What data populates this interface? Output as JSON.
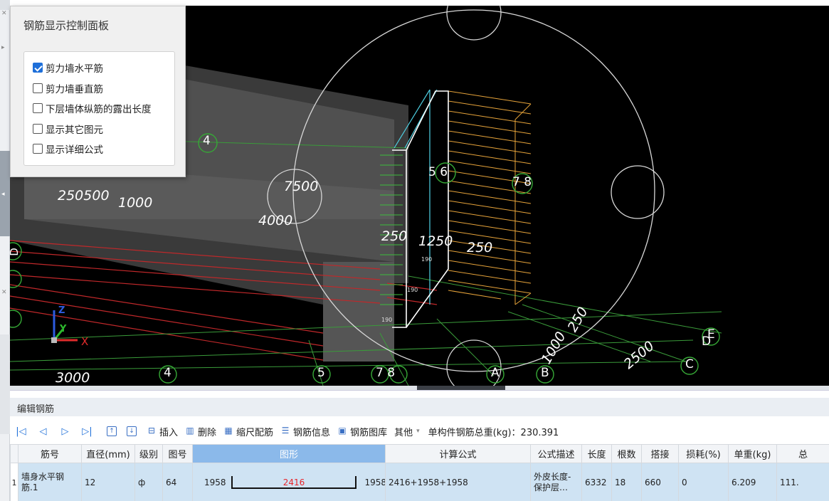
{
  "viewport": {
    "labels": {
      "dim_250_500": "250500",
      "dim_1000": "1000",
      "dim_7500": "7500",
      "dim_4000": "4000",
      "dim_250a": "250",
      "dim_1250": "1250",
      "dim_250b": "250",
      "dim_3000": "3000",
      "dim_2500": "2500",
      "dim_diag1": "1000",
      "dim_diag2": "250",
      "axis_4_top": "4",
      "axis_56": "5 6",
      "axis_78": "7 8",
      "axis_4_bottom": "4",
      "axis_5_bottom": "5",
      "axis_78_bottom": "7 8",
      "axis_a": "A",
      "axis_b": "B",
      "axis_c": "C",
      "axis_d": "D",
      "axis_e": "E",
      "left_dl": "D",
      "small_a": "190",
      "small_b": "190",
      "small_c": "190"
    },
    "axis_gizmo": {
      "z": "Z",
      "y": "Y",
      "x": "X"
    }
  },
  "control_panel": {
    "title": "钢筋显示控制面板",
    "options": [
      {
        "label": "剪力墙水平筋",
        "checked": true
      },
      {
        "label": "剪力墙垂直筋",
        "checked": false
      },
      {
        "label": "下层墙体纵筋的露出长度",
        "checked": false
      },
      {
        "label": "显示其它图元",
        "checked": false
      },
      {
        "label": "显示详细公式",
        "checked": false
      }
    ]
  },
  "edit_panel": {
    "title": "编辑钢筋",
    "toolbar": {
      "nav_first": "|◁",
      "nav_prev": "◁",
      "nav_next": "▷",
      "nav_last": "▷|",
      "move_up_icon": "↑",
      "move_down_icon": "↓",
      "insert": "插入",
      "delete": "删除",
      "scale": "缩尺配筋",
      "rebar_info": "钢筋信息",
      "rebar_library": "钢筋图库",
      "other": "其他",
      "total_label": "单构件钢筋总重(kg)：230.391"
    },
    "columns": [
      "筋号",
      "直径(mm)",
      "级别",
      "图号",
      "图形",
      "计算公式",
      "公式描述",
      "长度",
      "根数",
      "搭接",
      "损耗(%)",
      "单重(kg)",
      "总"
    ],
    "rows": [
      {
        "index": "1",
        "name": "墙身水平钢筋.1",
        "diameter": "12",
        "grade": "ф",
        "figure_no": "64",
        "shape_left": "1958",
        "shape_mid": "2416",
        "shape_right": "1958",
        "formula": "2416+1958+1958",
        "description": "外皮长度-保护层…",
        "length": "6332",
        "count": "18",
        "lap": "660",
        "loss": "0",
        "unit_weight": "6.209",
        "total": "111."
      }
    ]
  }
}
